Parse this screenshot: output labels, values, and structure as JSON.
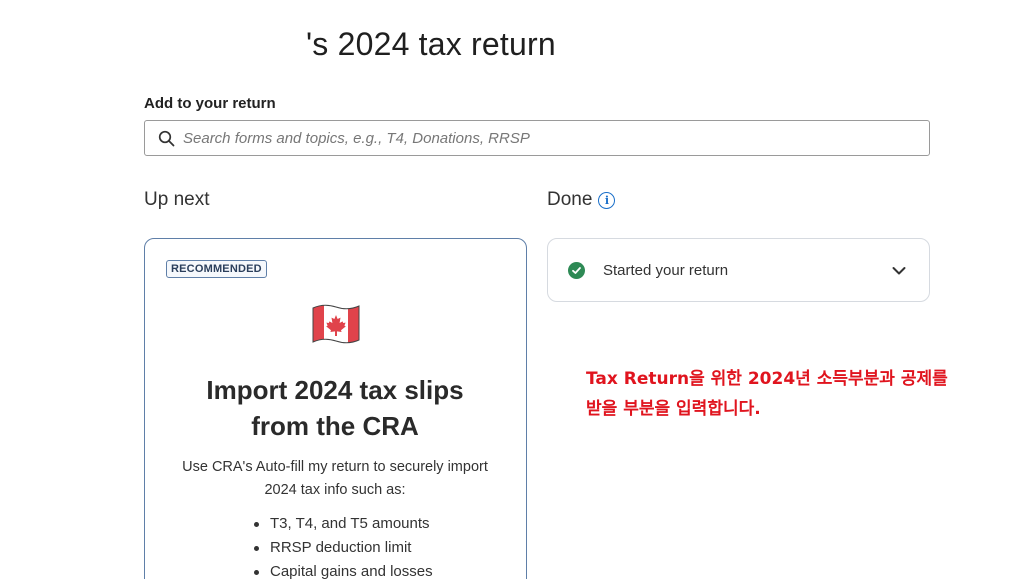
{
  "header": {
    "title": "'s 2024 tax return"
  },
  "search": {
    "label": "Add to your return",
    "placeholder": "Search forms and topics, e.g., T4, Donations, RRSP",
    "value": ""
  },
  "columns": {
    "up_next": "Up next",
    "done": "Done"
  },
  "recommended_card": {
    "badge": "RECOMMENDED",
    "icon": "canada-flag",
    "title_line1": "Import 2024 tax slips",
    "title_line2": "from the CRA",
    "desc_line1": "Use CRA's Auto-fill my return to securely import",
    "desc_line2": "2024 tax info such as:",
    "items": [
      "T3, T4, and T5 amounts",
      "RRSP deduction limit",
      "Capital gains and losses"
    ]
  },
  "done_card": {
    "label": "Started your return",
    "status": "completed"
  },
  "annotation": {
    "line1": "Tax Return을 위한 2024년 소득부분과 공제를",
    "line2": "받을 부분을 입력합니다."
  },
  "colors": {
    "accent": "#1a6fc9",
    "success": "#2e8a55",
    "annotation": "#e0141e",
    "card_border": "#5f7fa8"
  }
}
